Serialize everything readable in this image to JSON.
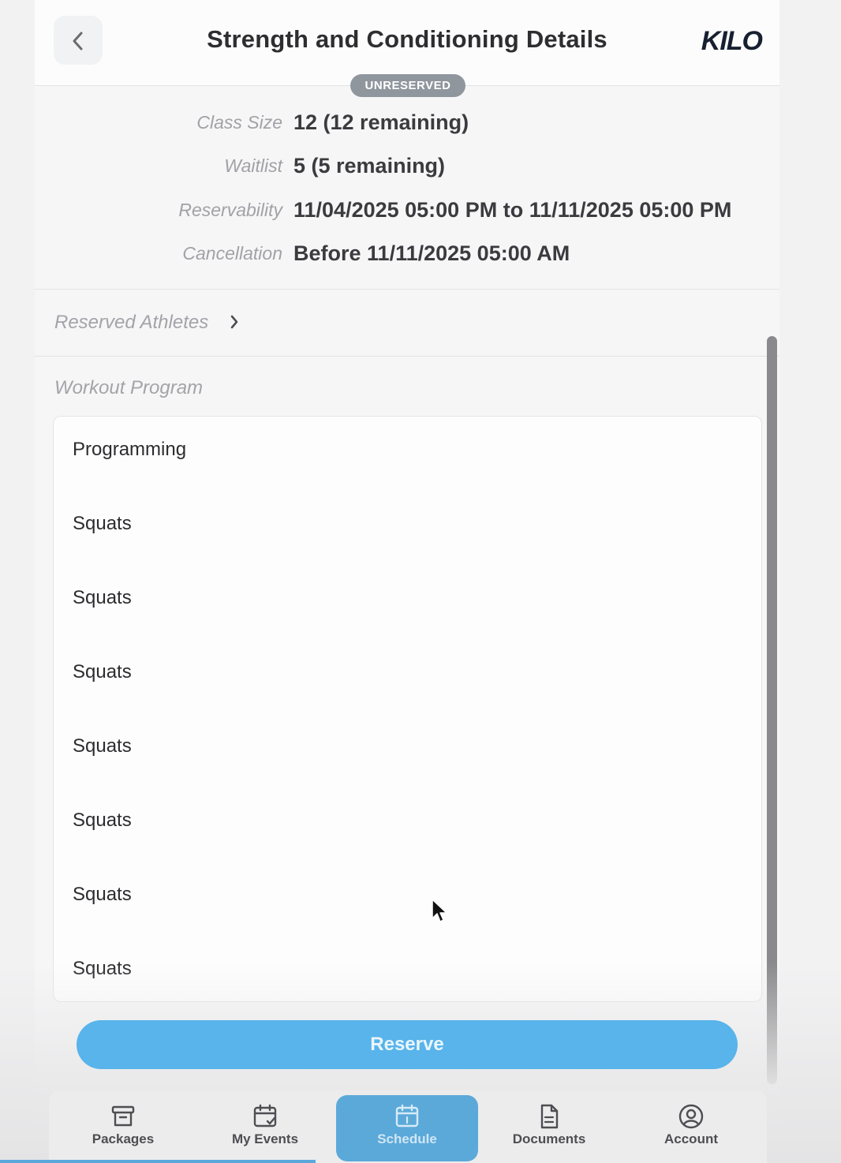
{
  "header": {
    "title": "Strength and Conditioning Details",
    "logo": "KILO",
    "status_badge": "UNRESERVED"
  },
  "info": [
    {
      "label": "Class Size",
      "value": "12 (12 remaining)"
    },
    {
      "label": "Waitlist",
      "value": "5 (5 remaining)"
    },
    {
      "label": "Reservability",
      "value": "11/04/2025 05:00 PM to 11/11/2025 05:00 PM"
    },
    {
      "label": "Cancellation",
      "value": "Before 11/11/2025 05:00 AM"
    }
  ],
  "reserved_athletes": {
    "label": "Reserved Athletes"
  },
  "workout": {
    "label": "Workout Program",
    "items": [
      "Programming",
      "Squats",
      "Squats",
      "Squats",
      "Squats",
      "Squats",
      "Squats",
      "Squats"
    ]
  },
  "reserve_button": {
    "label": "Reserve"
  },
  "nav": {
    "items": [
      {
        "label": "Packages",
        "icon": "archive-box-icon"
      },
      {
        "label": "My Events",
        "icon": "calendar-check-icon"
      },
      {
        "label": "Schedule",
        "icon": "calendar-icon",
        "active": true
      },
      {
        "label": "Documents",
        "icon": "document-icon"
      },
      {
        "label": "Account",
        "icon": "user-circle-icon"
      }
    ]
  },
  "colors": {
    "accent": "#58b4ea",
    "active_tab": "#5ba9d9",
    "badge": "#8f969e"
  }
}
